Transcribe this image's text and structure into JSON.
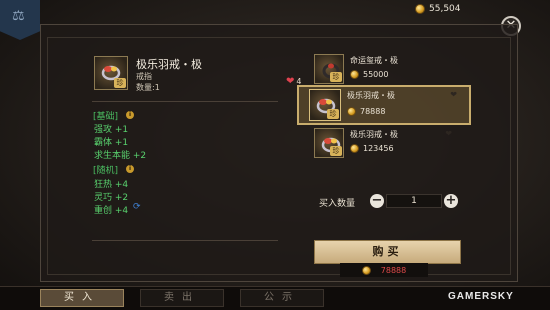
{
  "header": {
    "banner_icon": "scales-icon",
    "currency": {
      "icon": "gold-coin-icon",
      "amount": "55,504"
    },
    "close_label": "✕"
  },
  "selected_item": {
    "name": "极乐羽戒・极",
    "type": "戒指",
    "quantity": "数量:1",
    "favorites": "4",
    "rarity": "珍",
    "icon": "ring-icon"
  },
  "attributes": {
    "base_title": "[基础]",
    "base_stats": [
      "强攻 +1",
      "霸体 +1",
      "求生本能 +2"
    ],
    "random_title": "[随机]",
    "random_stats": [
      "狂热 +4",
      "灵巧 +2",
      "重创 +4"
    ]
  },
  "shop_list": {
    "items": [
      {
        "name": "命运玺戒・极",
        "price": "55000",
        "rarity": "珍",
        "icon": "ring-icon"
      },
      {
        "name": "极乐羽戒・极",
        "price": "78888",
        "rarity": "珍",
        "icon": "ring-icon"
      },
      {
        "name": "极乐羽戒・极",
        "price": "123456",
        "rarity": "珍",
        "icon": "ring-icon"
      }
    ]
  },
  "purchase": {
    "quantity_label": "买入数量",
    "quantity_value": "1",
    "minus_label": "−",
    "plus_label": "+",
    "buy_label": "购买",
    "total_price": "78888"
  },
  "bottom_tabs": [
    {
      "label": "买入",
      "active": true
    },
    {
      "label": "卖出",
      "active": false
    },
    {
      "label": "公示",
      "active": false
    }
  ],
  "watermark": "GAMERSKY",
  "colors": {
    "stat_green": "#58d06d",
    "price_red": "#e14a4a",
    "accent_gold": "#c9ad6d"
  }
}
